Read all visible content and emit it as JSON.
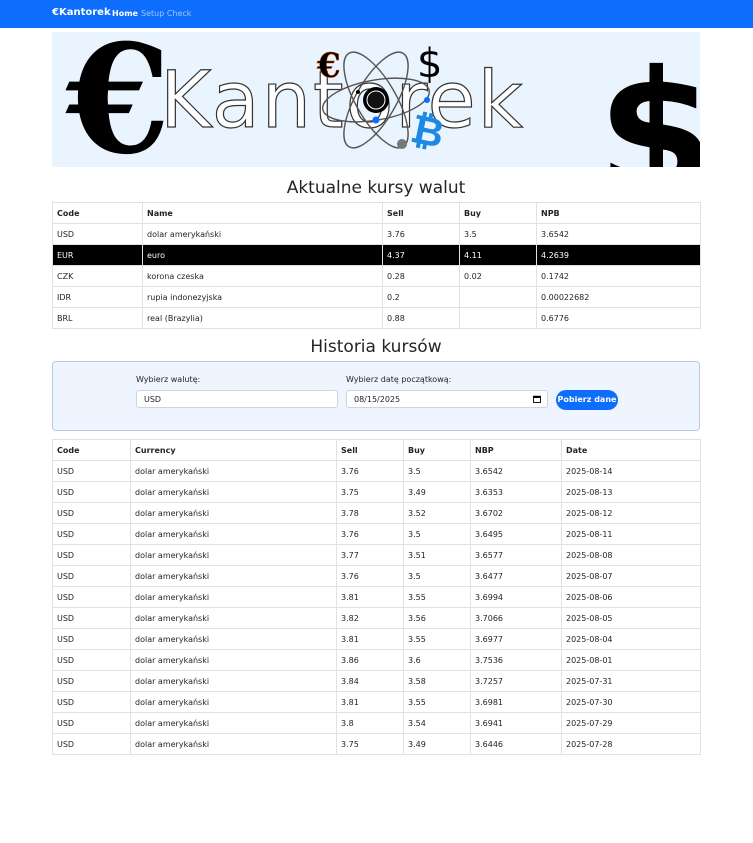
{
  "nav": {
    "brand": "€Kantorek",
    "home": "Home",
    "setup": "Setup Check"
  },
  "banner": {
    "brand_text": "Kantorek",
    "euro_glyph": "€",
    "dollar_glyph": "$",
    "bitcoin_glyph": "₿"
  },
  "rates": {
    "title": "Aktualne kursy walut",
    "headers": [
      "Code",
      "Name",
      "Sell",
      "Buy",
      "NPB"
    ],
    "rows": [
      [
        "USD",
        "dolar amerykański",
        "3.76",
        "3.5",
        "3.6542"
      ],
      [
        "EUR",
        "euro",
        "4.37",
        "4.11",
        "4.2639"
      ],
      [
        "CZK",
        "korona czeska",
        "0.28",
        "0.02",
        "0.1742"
      ],
      [
        "IDR",
        "rupia indonezyjska",
        "0.2",
        "",
        "0.00022682"
      ],
      [
        "BRL",
        "real (Brazylia)",
        "0.88",
        "",
        "0.6776"
      ]
    ],
    "highlighted_row": 1
  },
  "history": {
    "title": "Historia kursów",
    "currency_label": "Wybierz walutę:",
    "currency_value": "USD",
    "date_label": "Wybierz datę początkową:",
    "date_value": "08/15/2025",
    "button": "Pobierz dane",
    "headers": [
      "Code",
      "Currency",
      "Sell",
      "Buy",
      "NBP",
      "Date"
    ],
    "rows": [
      [
        "USD",
        "dolar amerykański",
        "3.76",
        "3.5",
        "3.6542",
        "2025-08-14"
      ],
      [
        "USD",
        "dolar amerykański",
        "3.75",
        "3.49",
        "3.6353",
        "2025-08-13"
      ],
      [
        "USD",
        "dolar amerykański",
        "3.78",
        "3.52",
        "3.6702",
        "2025-08-12"
      ],
      [
        "USD",
        "dolar amerykański",
        "3.76",
        "3.5",
        "3.6495",
        "2025-08-11"
      ],
      [
        "USD",
        "dolar amerykański",
        "3.77",
        "3.51",
        "3.6577",
        "2025-08-08"
      ],
      [
        "USD",
        "dolar amerykański",
        "3.76",
        "3.5",
        "3.6477",
        "2025-08-07"
      ],
      [
        "USD",
        "dolar amerykański",
        "3.81",
        "3.55",
        "3.6994",
        "2025-08-06"
      ],
      [
        "USD",
        "dolar amerykański",
        "3.82",
        "3.56",
        "3.7066",
        "2025-08-05"
      ],
      [
        "USD",
        "dolar amerykański",
        "3.81",
        "3.55",
        "3.6977",
        "2025-08-04"
      ],
      [
        "USD",
        "dolar amerykański",
        "3.86",
        "3.6",
        "3.7536",
        "2025-08-01"
      ],
      [
        "USD",
        "dolar amerykański",
        "3.84",
        "3.58",
        "3.7257",
        "2025-07-31"
      ],
      [
        "USD",
        "dolar amerykański",
        "3.81",
        "3.55",
        "3.6981",
        "2025-07-30"
      ],
      [
        "USD",
        "dolar amerykański",
        "3.8",
        "3.54",
        "3.6941",
        "2025-07-29"
      ],
      [
        "USD",
        "dolar amerykański",
        "3.75",
        "3.49",
        "3.6446",
        "2025-07-28"
      ]
    ]
  },
  "colors": {
    "primary": "#0d6efd",
    "banner_bg": "#eaf4ff",
    "highlight_row": "#000000"
  }
}
